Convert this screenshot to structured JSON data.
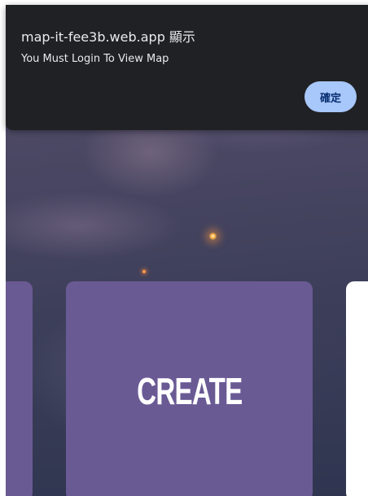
{
  "dialog": {
    "title": "map-it-fee3b.web.app 顯示",
    "message": "You Must Login To View Map",
    "ok_label": "確定"
  },
  "main": {
    "create_label": "CREATE"
  },
  "colors": {
    "card_purple": "#6a5a94",
    "dialog_background": "#202124",
    "ok_button": "#a8c7fa"
  }
}
